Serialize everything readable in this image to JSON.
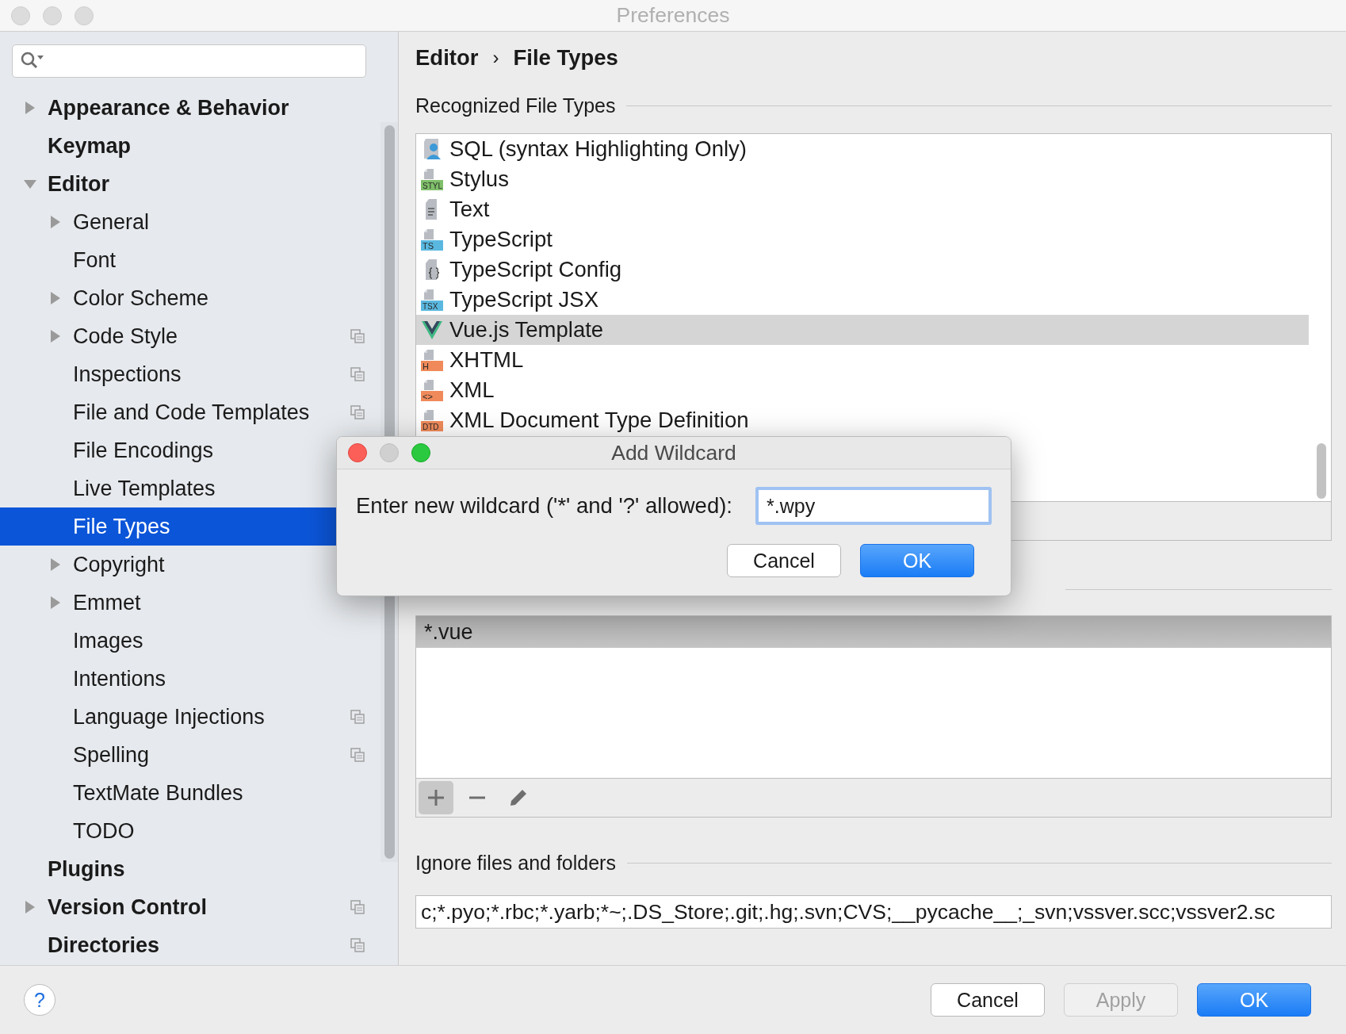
{
  "window": {
    "title": "Preferences"
  },
  "sidebar": {
    "items": [
      {
        "label": "Appearance & Behavior",
        "expanded": false,
        "selected": false,
        "project_icon": false
      },
      {
        "label": "Keymap",
        "selected": false,
        "project_icon": false
      },
      {
        "label": "Editor",
        "expanded": true,
        "selected": false,
        "project_icon": false,
        "children": [
          {
            "label": "General",
            "expanded": false,
            "selected": false,
            "project_icon": false
          },
          {
            "label": "Font",
            "selected": false,
            "project_icon": false
          },
          {
            "label": "Color Scheme",
            "expanded": false,
            "selected": false,
            "project_icon": false
          },
          {
            "label": "Code Style",
            "expanded": false,
            "selected": false,
            "project_icon": true
          },
          {
            "label": "Inspections",
            "selected": false,
            "project_icon": true
          },
          {
            "label": "File and Code Templates",
            "selected": false,
            "project_icon": true
          },
          {
            "label": "File Encodings",
            "selected": false
          },
          {
            "label": "Live Templates",
            "selected": false
          },
          {
            "label": "File Types",
            "selected": true
          },
          {
            "label": "Copyright",
            "expanded": false,
            "selected": false
          },
          {
            "label": "Emmet",
            "expanded": false,
            "selected": false,
            "project_icon": false
          },
          {
            "label": "Images",
            "selected": false,
            "project_icon": false
          },
          {
            "label": "Intentions",
            "selected": false,
            "project_icon": false
          },
          {
            "label": "Language Injections",
            "selected": false,
            "project_icon": true
          },
          {
            "label": "Spelling",
            "selected": false,
            "project_icon": true
          },
          {
            "label": "TextMate Bundles",
            "selected": false,
            "project_icon": false
          },
          {
            "label": "TODO",
            "selected": false,
            "project_icon": false
          }
        ]
      },
      {
        "label": "Plugins",
        "selected": false,
        "project_icon": false
      },
      {
        "label": "Version Control",
        "expanded": false,
        "selected": false,
        "project_icon": true
      },
      {
        "label": "Directories",
        "selected": false,
        "project_icon": true
      }
    ]
  },
  "breadcrumb": {
    "items": [
      "Editor",
      "File Types"
    ],
    "separator": "›"
  },
  "recognized_file_types": {
    "title": "Recognized File Types",
    "items": [
      {
        "name": "SQL (syntax Highlighting Only)",
        "kind": "person",
        "selected": false
      },
      {
        "name": "Stylus",
        "kind": "badge",
        "badge": "STYL",
        "color": "#7fbf6a",
        "selected": false
      },
      {
        "name": "Text",
        "kind": "text",
        "selected": false
      },
      {
        "name": "TypeScript",
        "kind": "badge",
        "badge": "TS",
        "color": "#5ab8e0",
        "selected": false
      },
      {
        "name": "TypeScript Config",
        "kind": "config",
        "selected": false
      },
      {
        "name": "TypeScript JSX",
        "kind": "badge",
        "badge": "TSX",
        "color": "#5ab8e0",
        "selected": false
      },
      {
        "name": "Vue.js Template",
        "kind": "vue",
        "selected": true
      },
      {
        "name": "XHTML",
        "kind": "badge",
        "badge": "H",
        "color": "#f08a5a",
        "selected": false
      },
      {
        "name": "XML",
        "kind": "badge",
        "badge": "<>",
        "color": "#f08a5a",
        "selected": false
      },
      {
        "name": "XML Document Type Definition",
        "kind": "badge",
        "badge": "DTD",
        "color": "#f08a5a",
        "selected": false
      }
    ]
  },
  "registered_patterns": {
    "items": [
      {
        "pattern": "*.vue",
        "selected": true
      }
    ]
  },
  "ignore": {
    "label": "Ignore files and folders",
    "value": "c;*.pyo;*.rbc;*.yarb;*~;.DS_Store;.git;.hg;.svn;CVS;__pycache__;_svn;vssver.scc;vssver2.sc"
  },
  "help": {
    "label": "?"
  },
  "buttons": [
    {
      "label": "Cancel",
      "kind": "normal"
    },
    {
      "label": "Apply",
      "kind": "disabled"
    },
    {
      "label": "OK",
      "kind": "default"
    }
  ],
  "dialog": {
    "title": "Add Wildcard",
    "prompt": "Enter new wildcard ('*' and '?' allowed):",
    "value": "*.wpy",
    "buttons": [
      {
        "label": "Cancel",
        "kind": "normal"
      },
      {
        "label": "OK",
        "kind": "default"
      }
    ]
  }
}
